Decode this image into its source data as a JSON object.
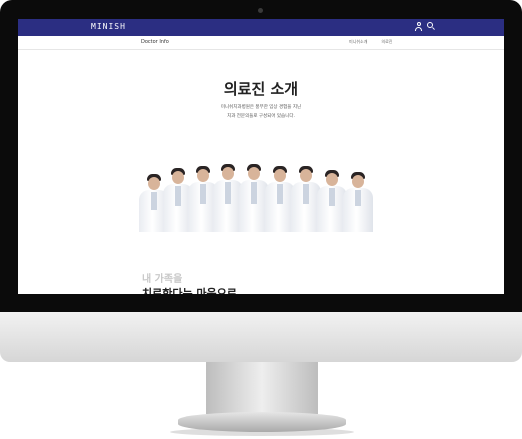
{
  "navbar": {
    "logo": "MINISH",
    "brand_color": "#2b2e82",
    "icons": [
      "user-icon",
      "search-icon"
    ]
  },
  "subnav": {
    "title": "Doctor Info",
    "links": [
      "미니쉬소개",
      "의료진"
    ]
  },
  "main": {
    "heading": "의료진 소개",
    "description_lines": [
      "미니쉬치과병원은 풍부한 임상 경험을 지닌",
      "치과 전문의들로 구성되어 있습니다."
    ],
    "tagline_line1": "내 가족을",
    "tagline_line2": "치료한다는 마음으로"
  }
}
